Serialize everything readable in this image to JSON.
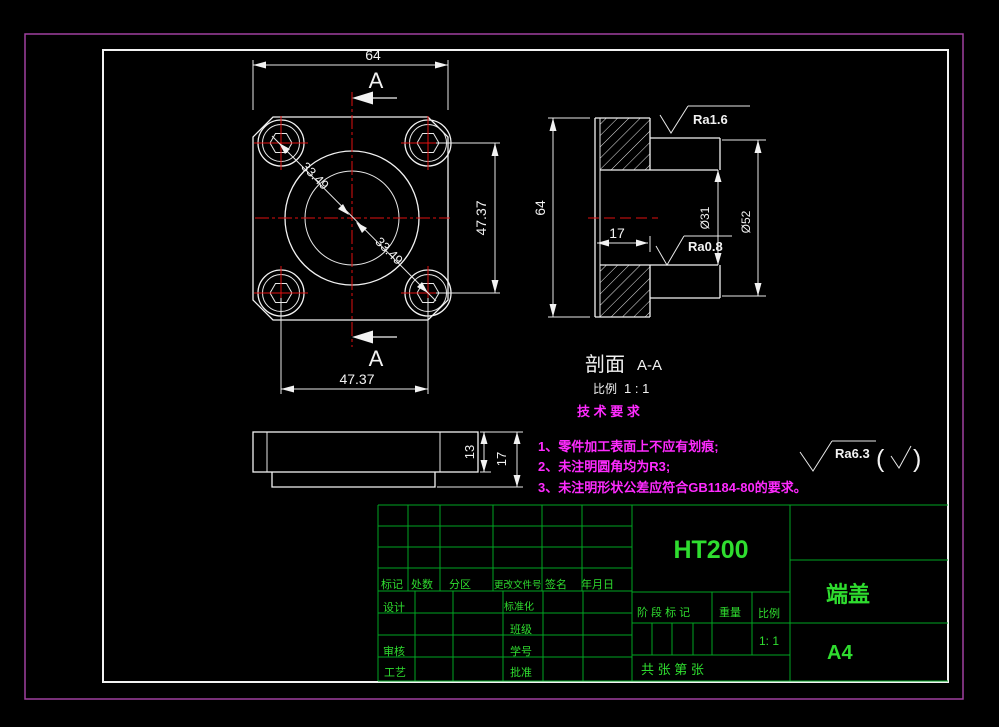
{
  "colors": {
    "line_white": "#f2f2f2",
    "centerline_red": "#e01010",
    "table_green": "#00a422",
    "text_green": "#2fdd2f",
    "note_magenta": "#ff2bff",
    "border_purple": "#a040a0"
  },
  "front_view": {
    "dim_width": "64",
    "dim_bolt_horizontal": "47.37",
    "dim_bolt_vertical": "47.37",
    "dim_diag_upper": "33.49",
    "dim_diag_lower": "33.49",
    "section_label_top": "A",
    "section_label_bottom": "A"
  },
  "side_view": {
    "dim_plate": "13",
    "dim_total": "17"
  },
  "section_view": {
    "dim_height": "64",
    "dim_depth": "17",
    "dim_bore": "Ø31",
    "dim_boss": "Ø52",
    "ra_flange": "Ra1.6",
    "ra_bore": "Ra0.8",
    "caption": "剖面",
    "caption_detail": "A-A",
    "scale_label": "比例",
    "scale_value": "1 : 1"
  },
  "tech_requirements": {
    "heading": "技 术 要 求",
    "items": [
      "1、零件加工表面上不应有划痕;",
      "2、未注明圆角均为R3;",
      "3、未注明形状公差应符合GB1184-80的要求。"
    ],
    "ra_general": "Ra6.3",
    "paren_open": "(",
    "paren_close": ")"
  },
  "title_block": {
    "material": "HT200",
    "part_name": "端盖",
    "paper_size": "A4",
    "scale_value": "1: 1",
    "sheet_note": "共  张 第  张",
    "stage_label": "阶 段 标 记",
    "weight_label": "重量",
    "scale_label": "比例",
    "rev_labels": {
      "mark": "标记",
      "count": "处数",
      "zone": "分区",
      "doc_no": "更改文件号",
      "sign": "签名",
      "date": "年月日"
    },
    "roles": {
      "design": "设计",
      "check": "审核",
      "process": "工艺",
      "standard": "标准化",
      "class_no": "班级",
      "student_no": "学号",
      "approve": "批准"
    }
  }
}
